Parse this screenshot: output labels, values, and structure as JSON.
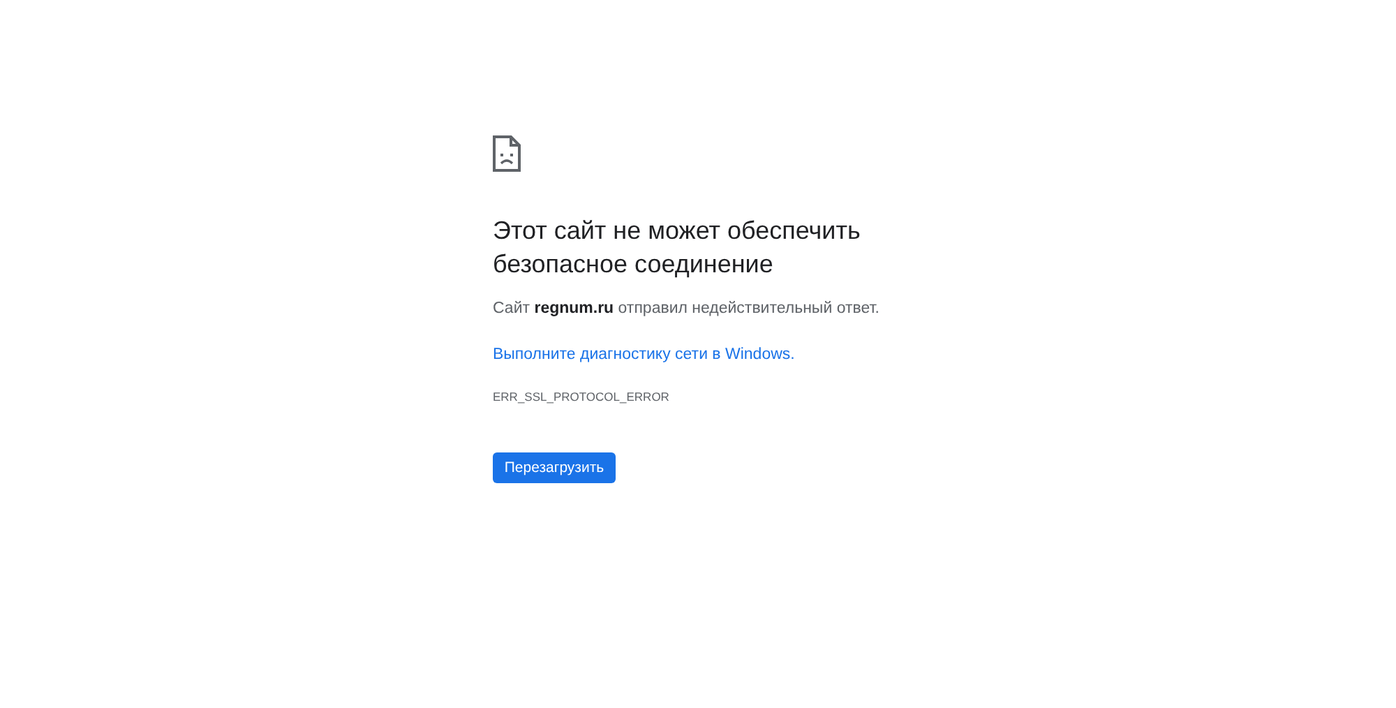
{
  "heading": "Этот сайт не может обеспечить безопасное соединение",
  "message": "Сайт **regnum.ru** отправил недействительный ответ.",
  "link": "Выполните диагностику сети в Windows.",
  "error_code": "ERR_SSL_PROTOCOL_ERROR",
  "button": "Перезагрузить"
}
